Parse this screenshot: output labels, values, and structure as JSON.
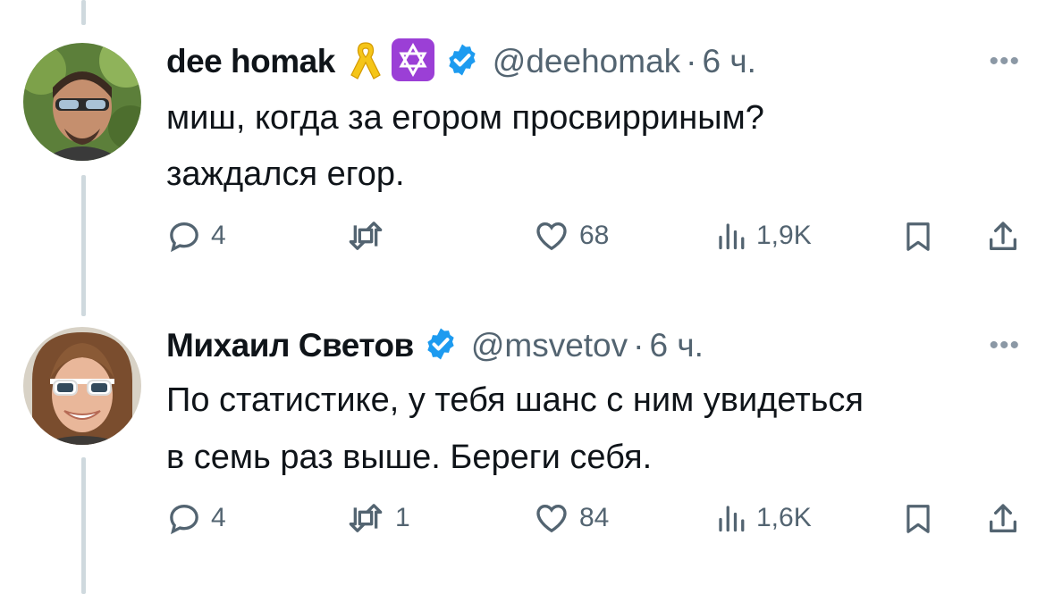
{
  "tweets": [
    {
      "display_name": "dee homak",
      "handle": "@deehomak",
      "separator": "·",
      "time": "6 ч.",
      "badges": [
        "yellow-ribbon-icon",
        "star-of-david-icon",
        "verified-badge-icon"
      ],
      "text_lines": [
        "миш, когда за егором просвирриным?",
        "заждался егор."
      ],
      "replies": "4",
      "retweets": "",
      "likes": "68",
      "views": "1,9K"
    },
    {
      "display_name": "Михаил Светов",
      "handle": "@msvetov",
      "separator": "·",
      "time": "6 ч.",
      "badges": [
        "verified-badge-icon"
      ],
      "text_lines": [
        "По статистике, у тебя шанс с ним увидеться",
        "в семь раз выше. Береги себя."
      ],
      "replies": "4",
      "retweets": "1",
      "likes": "84",
      "views": "1,6K"
    }
  ],
  "more_label": "•••",
  "colors": {
    "text": "#0f1419",
    "secondary": "#536471",
    "verified": "#1d9bf0",
    "thread_line": "#cfd9de",
    "ribbon": "#f5c518",
    "star_badge": "#9b3fd6"
  }
}
